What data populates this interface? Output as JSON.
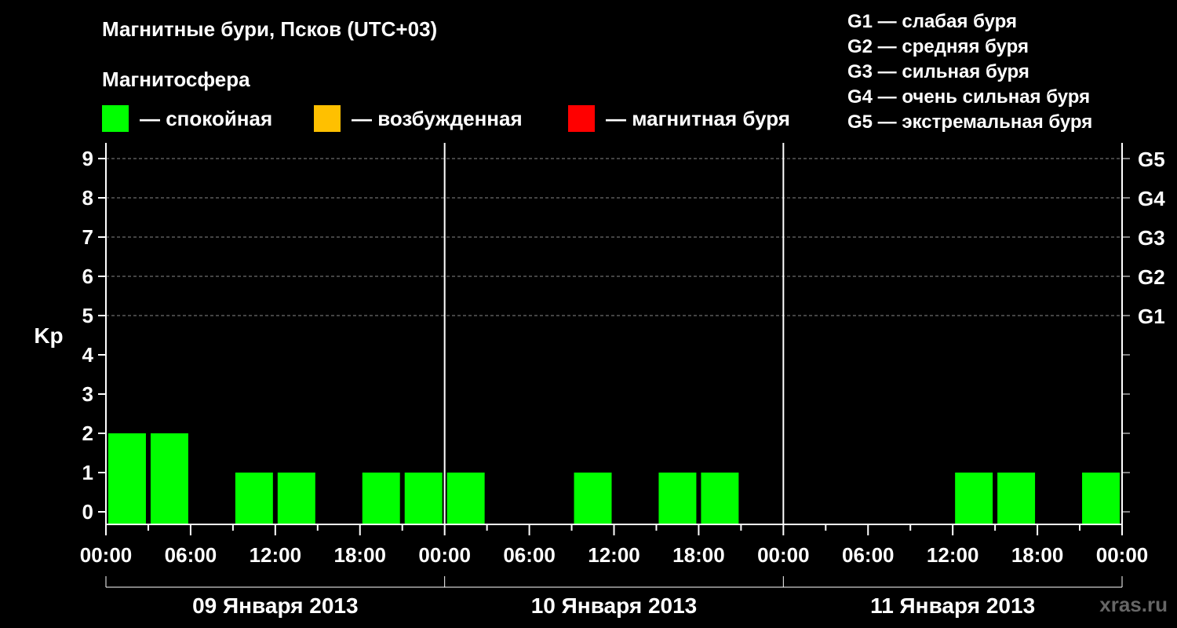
{
  "title": "Магнитные бури, Псков (UTC+03)",
  "subtitle": "Магнитосфера",
  "legend": [
    {
      "label": "— спокойная",
      "color": "#00ff00"
    },
    {
      "label": "— возбужденная",
      "color": "#ffc000"
    },
    {
      "label": "— магнитная буря",
      "color": "#ff0000"
    }
  ],
  "g_levels": [
    "G1 — слабая буря",
    "G2 — средняя буря",
    "G3 — сильная буря",
    "G4 — очень сильная буря",
    "G5 — экстремальная буря"
  ],
  "watermark": "xras.ru",
  "chart_data": {
    "type": "bar",
    "ylabel": "Kp",
    "ylim": [
      0,
      9
    ],
    "yticks": [
      "0",
      "1",
      "2",
      "3",
      "4",
      "5",
      "6",
      "7",
      "8",
      "9"
    ],
    "right_ticks": [
      {
        "value": 5,
        "label": "G1"
      },
      {
        "value": 6,
        "label": "G2"
      },
      {
        "value": 7,
        "label": "G3"
      },
      {
        "value": 8,
        "label": "G4"
      },
      {
        "value": 9,
        "label": "G5"
      }
    ],
    "xtick_labels": [
      "00:00",
      "06:00",
      "12:00",
      "18:00",
      "00:00",
      "06:00",
      "12:00",
      "18:00",
      "00:00",
      "06:00",
      "12:00",
      "18:00",
      "00:00"
    ],
    "days": [
      "09 Января 2013",
      "10 Января 2013",
      "11 Января 2013"
    ],
    "interval_hours": 3,
    "values": [
      2,
      2,
      0,
      1,
      1,
      0,
      1,
      1,
      1,
      0,
      0,
      1,
      0,
      1,
      1,
      0,
      0,
      0,
      0,
      0,
      1,
      1,
      0,
      1
    ],
    "bar_color": "#00ff00",
    "grid": "dashed at Kp 5-9"
  }
}
